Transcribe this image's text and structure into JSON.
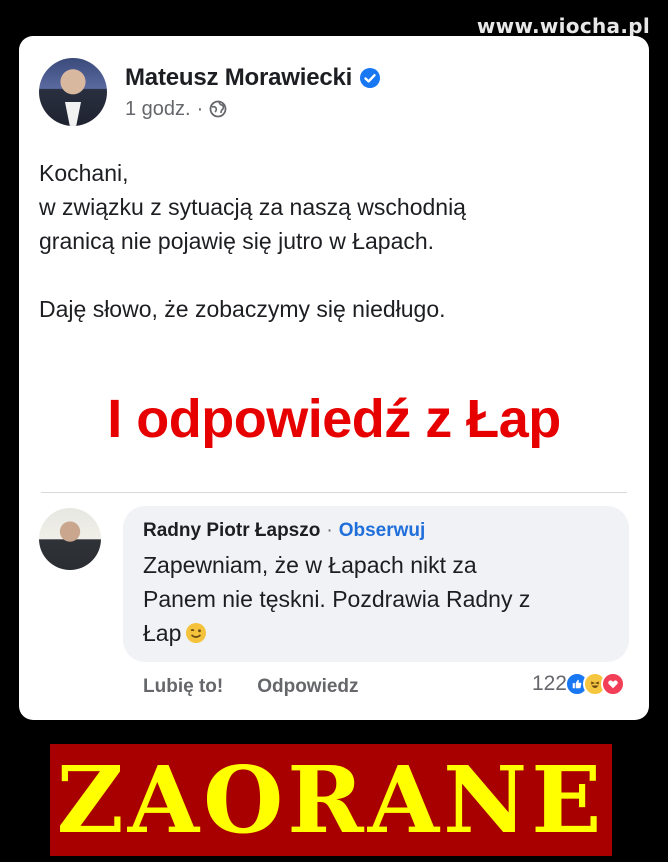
{
  "watermark": "www.wiocha.pl",
  "post": {
    "author": "Mateusz Morawiecki",
    "time": "1 godz.",
    "dot": "·",
    "body_p1": "Kochani,\nw związku z sytuacją za naszą wschodnią\ngranicą nie pojawię się jutro w Łapach.",
    "body_p2": "Daję słowo, że zobaczymy się niedługo."
  },
  "headline": "I odpowiedź z Łap",
  "comment": {
    "author": "Radny Piotr Łapszo",
    "sep": "·",
    "follow": "Obserwuj",
    "text": "Zapewniam, że w Łapach nikt za\nPanem nie tęskni. Pozdrawia Radny z\nŁap",
    "like_label": "Lubię to!",
    "reply_label": "Odpowiedz",
    "reaction_count": "122"
  },
  "banner": "ZAORANE",
  "colors": {
    "headline_red": "#e60000",
    "link_blue": "#216fdb",
    "banner_bg": "#a80000",
    "banner_text": "#ffff00"
  },
  "icons": [
    "verified-icon",
    "globe-icon",
    "wink-emoji-icon",
    "like-reaction-icon",
    "haha-reaction-icon",
    "love-reaction-icon"
  ]
}
